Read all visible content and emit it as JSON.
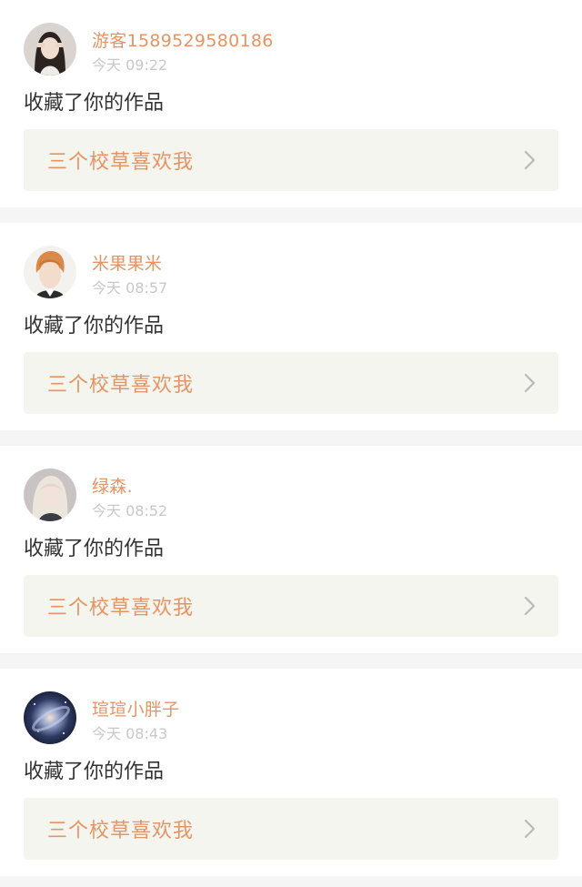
{
  "notifications": [
    {
      "user_name": "游客1589529580186",
      "time": "今天 09:22",
      "action": "收藏了你的作品",
      "work_title": "三个校草喜欢我",
      "avatar_icon": "avatar-girl-hands-icon",
      "avatar_colors": [
        "#d9d4cf",
        "#2a2320",
        "#f0ddd0"
      ]
    },
    {
      "user_name": "米果果米",
      "time": "今天 08:57",
      "action": "收藏了你的作品",
      "work_title": "三个校草喜欢我",
      "avatar_icon": "avatar-boy-orange-hair-icon",
      "avatar_colors": [
        "#f4f2ee",
        "#d98a4a",
        "#f3dccb"
      ]
    },
    {
      "user_name": "绿森.",
      "time": "今天 08:52",
      "action": "收藏了你的作品",
      "work_title": "三个校草喜欢我",
      "avatar_icon": "avatar-blonde-girl-icon",
      "avatar_colors": [
        "#c9c3c4",
        "#ece5dc",
        "#f1e2db"
      ]
    },
    {
      "user_name": "瑄瑄小胖子",
      "time": "今天 08:43",
      "action": "收藏了你的作品",
      "work_title": "三个校草喜欢我",
      "avatar_icon": "avatar-galaxy-icon",
      "avatar_colors": [
        "#1b2238",
        "#6d7fb0",
        "#e3c9b8"
      ]
    }
  ],
  "colors": {
    "accent": "#e69463",
    "time": "#c8c8c8",
    "text": "#333333",
    "link_bg": "#f5f5ef",
    "separator": "#f6f5f5"
  }
}
